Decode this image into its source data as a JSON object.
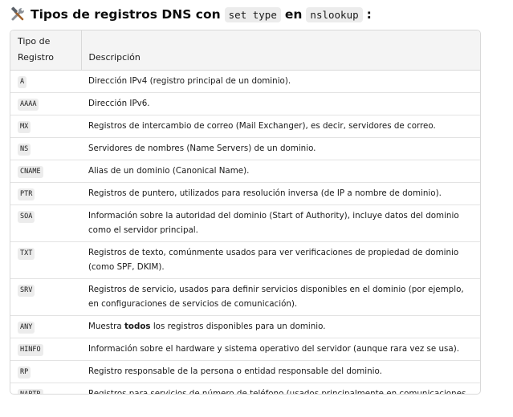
{
  "heading": {
    "icon": "hammer-and-wrench-icon",
    "title_part1": "Tipos de registros DNS con",
    "code1": "set type",
    "title_part2": "en",
    "code2": "nslookup",
    "title_part3": ":"
  },
  "table": {
    "headers": {
      "type_line1": "Tipo de",
      "type_line2": "Registro",
      "description": "Descripción"
    },
    "rows": [
      {
        "type": "A",
        "description": "Dirección IPv4 (registro principal de un dominio)."
      },
      {
        "type": "AAAA",
        "description": "Dirección IPv6."
      },
      {
        "type": "MX",
        "description": "Registros de intercambio de correo (Mail Exchanger), es decir, servidores de correo."
      },
      {
        "type": "NS",
        "description": "Servidores de nombres (Name Servers) de un dominio."
      },
      {
        "type": "CNAME",
        "description": "Alias de un dominio (Canonical Name)."
      },
      {
        "type": "PTR",
        "description": "Registros de puntero, utilizados para resolución inversa (de IP a nombre de dominio)."
      },
      {
        "type": "SOA",
        "description": "Información sobre la autoridad del dominio (Start of Authority), incluye datos del dominio como el servidor principal."
      },
      {
        "type": "TXT",
        "description": "Registros de texto, comúnmente usados para ver verificaciones de propiedad de dominio (como SPF, DKIM)."
      },
      {
        "type": "SRV",
        "description": "Registros de servicio, usados para definir servicios disponibles en el dominio (por ejemplo, en configuraciones de servicios de comunicación)."
      },
      {
        "type": "ANY",
        "description_pre": "Muestra ",
        "description_bold": "todos",
        "description_post": " los registros disponibles para un dominio."
      },
      {
        "type": "HINFO",
        "description": "Información sobre el hardware y sistema operativo del servidor (aunque rara vez se usa)."
      },
      {
        "type": "RP",
        "description": "Registro responsable de la persona o entidad responsable del dominio."
      },
      {
        "type": "NAPTR",
        "description": "Registros para servicios de número de teléfono (usados principalmente en comunicaciones VoIP)."
      }
    ]
  }
}
